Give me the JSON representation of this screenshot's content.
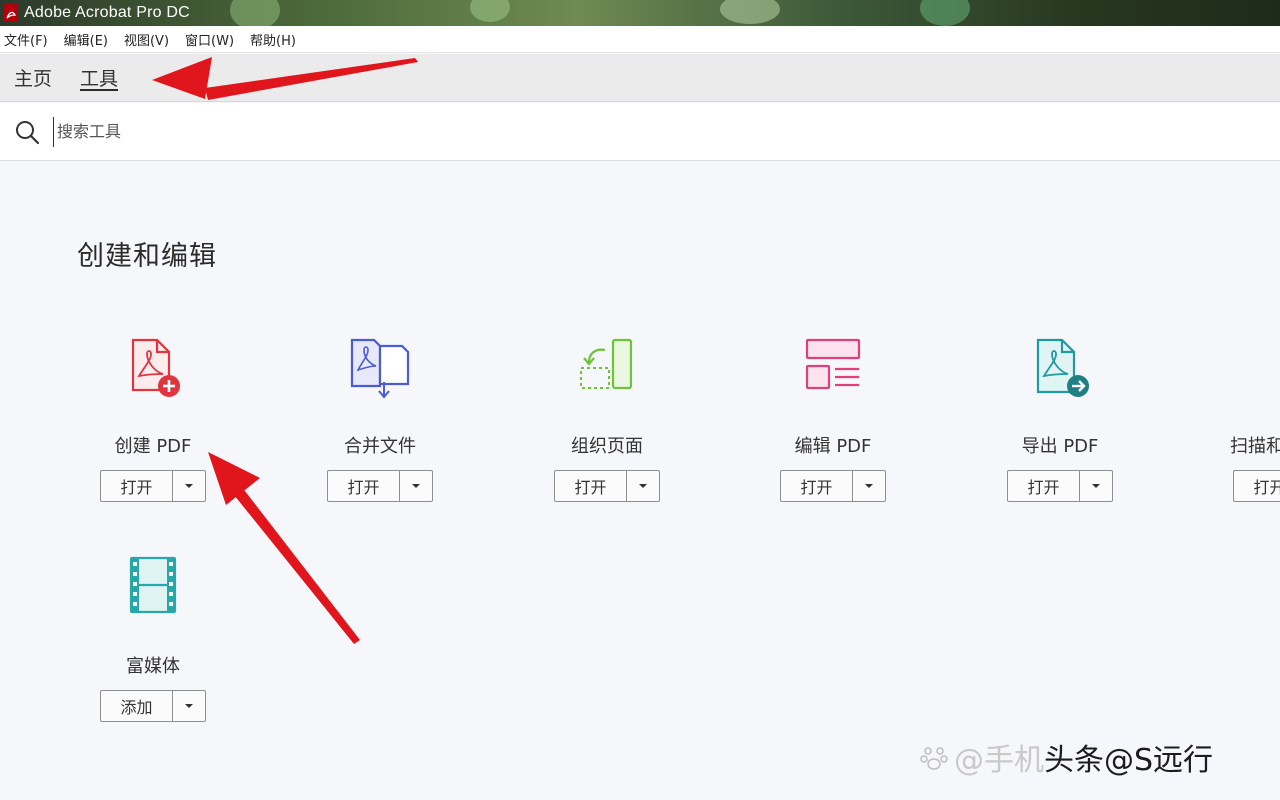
{
  "window": {
    "title": "Adobe Acrobat Pro DC"
  },
  "menu": [
    "文件(F)",
    "编辑(E)",
    "视图(V)",
    "窗口(W)",
    "帮助(H)"
  ],
  "tabs": [
    {
      "label": "主页",
      "active": false
    },
    {
      "label": "工具",
      "active": true
    }
  ],
  "search": {
    "placeholder": "搜索工具"
  },
  "section": {
    "title": "创建和编辑"
  },
  "tools": [
    {
      "label": "创建 PDF",
      "button": "打开",
      "icon": "create-pdf-icon",
      "color": "#e0353d"
    },
    {
      "label": "合并文件",
      "button": "打开",
      "icon": "combine-files-icon",
      "color": "#4b5bd2"
    },
    {
      "label": "组织页面",
      "button": "打开",
      "icon": "organize-pages-icon",
      "color": "#6fc23a"
    },
    {
      "label": "编辑 PDF",
      "button": "打开",
      "icon": "edit-pdf-icon",
      "color": "#e0407a"
    },
    {
      "label": "导出 PDF",
      "button": "打开",
      "icon": "export-pdf-icon",
      "color": "#1e9aa0"
    },
    {
      "label": "扫描和",
      "button": "打开",
      "icon": "scan-icon",
      "color": "#3eb55a"
    },
    {
      "label": "富媒体",
      "button": "添加",
      "icon": "rich-media-icon",
      "color": "#27a7a7"
    }
  ],
  "watermark": {
    "prefix": "@手机",
    "text": "头条@S远行"
  },
  "annotation_color": "#e0161c"
}
